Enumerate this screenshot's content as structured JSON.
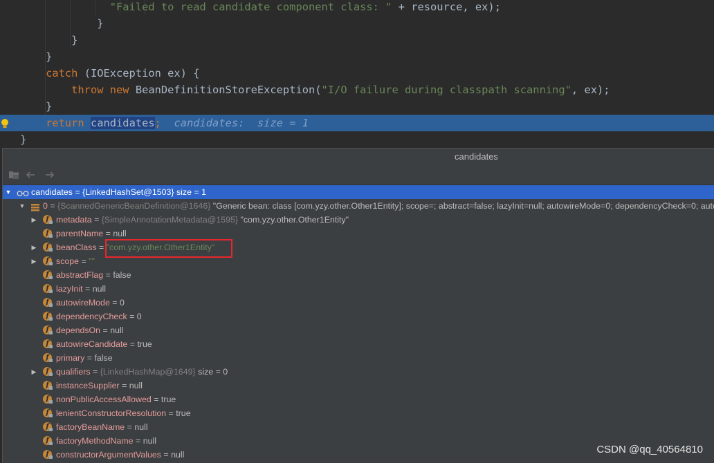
{
  "editor": {
    "lines": [
      {
        "indent": "              ",
        "parts": [
          {
            "t": "\"Failed to read candidate component class: \"",
            "c": "str"
          },
          {
            "t": " + resource, ex);",
            "c": ""
          }
        ]
      },
      {
        "indent": "            ",
        "parts": [
          {
            "t": "}",
            "c": ""
          }
        ]
      },
      {
        "indent": "        ",
        "parts": [
          {
            "t": "}",
            "c": ""
          }
        ]
      },
      {
        "indent": "    ",
        "parts": [
          {
            "t": "}",
            "c": ""
          }
        ]
      },
      {
        "indent": "    ",
        "parts": [
          {
            "t": "catch",
            "c": "kw"
          },
          {
            "t": " (IOException ex) {",
            "c": ""
          }
        ]
      },
      {
        "indent": "        ",
        "parts": [
          {
            "t": "throw new",
            "c": "kw"
          },
          {
            "t": " BeanDefinitionStoreException(",
            "c": ""
          },
          {
            "t": "\"I/O failure during classpath scanning\"",
            "c": "str"
          },
          {
            "t": ", ex);",
            "c": ""
          }
        ]
      },
      {
        "indent": "    ",
        "parts": [
          {
            "t": "}",
            "c": ""
          }
        ]
      },
      {
        "indent": "    ",
        "parts": [
          {
            "t": "return",
            "c": "kw"
          },
          {
            "t": " ",
            "c": ""
          },
          {
            "t": "candidates",
            "c": "sel"
          },
          {
            "t": ";",
            "c": "kw"
          },
          {
            "t": "  candidates:  size = 1",
            "c": "hint"
          }
        ]
      },
      {
        "indent": "",
        "parts": [
          {
            "t": "}",
            "c": ""
          }
        ]
      }
    ]
  },
  "popup": {
    "title": "candidates",
    "toolbar": {
      "icons": [
        "folder-icon",
        "back-arrow-icon",
        "forward-arrow-icon"
      ]
    },
    "root": {
      "name": "candidates",
      "value": " = ",
      "ref": "{LinkedHashSet@1503}",
      "extra": "  size = 1"
    },
    "element": {
      "name": "0",
      "value": " = ",
      "ref": "{ScannedGenericBeanDefinition@1646}",
      "extra": " \"Generic bean: class [com.yzy.other.Other1Entity]; scope=; abstract=false; lazyInit=null; autowireMode=0; dependencyCheck=0; autowireCandidate=true; primary=false\""
    },
    "fields": [
      {
        "name": "metadata",
        "expandable": true,
        "ref": "{SimpleAnnotationMetadata@1595}",
        "value": " \"com.yzy.other.Other1Entity\"",
        "kind": "plainstr"
      },
      {
        "name": "parentName",
        "expandable": false,
        "value": "null",
        "kind": "plain"
      },
      {
        "name": "beanClass",
        "expandable": true,
        "value": "\"com.yzy.other.Other1Entity\"",
        "kind": "str"
      },
      {
        "name": "scope",
        "expandable": true,
        "value": "\"\"",
        "kind": "str"
      },
      {
        "name": "abstractFlag",
        "expandable": false,
        "value": "false",
        "kind": "plain"
      },
      {
        "name": "lazyInit",
        "expandable": false,
        "value": "null",
        "kind": "plain"
      },
      {
        "name": "autowireMode",
        "expandable": false,
        "value": "0",
        "kind": "plain"
      },
      {
        "name": "dependencyCheck",
        "expandable": false,
        "value": "0",
        "kind": "plain"
      },
      {
        "name": "dependsOn",
        "expandable": false,
        "value": "null",
        "kind": "plain"
      },
      {
        "name": "autowireCandidate",
        "expandable": false,
        "value": "true",
        "kind": "plain"
      },
      {
        "name": "primary",
        "expandable": false,
        "value": "false",
        "kind": "plain"
      },
      {
        "name": "qualifiers",
        "expandable": true,
        "ref": "{LinkedHashMap@1649}",
        "value": "  size = 0",
        "kind": "ref"
      },
      {
        "name": "instanceSupplier",
        "expandable": false,
        "value": "null",
        "kind": "plain"
      },
      {
        "name": "nonPublicAccessAllowed",
        "expandable": false,
        "value": "true",
        "kind": "plain"
      },
      {
        "name": "lenientConstructorResolution",
        "expandable": false,
        "value": "true",
        "kind": "plain"
      },
      {
        "name": "factoryBeanName",
        "expandable": false,
        "value": "null",
        "kind": "plain"
      },
      {
        "name": "factoryMethodName",
        "expandable": false,
        "value": "null",
        "kind": "plain"
      },
      {
        "name": "constructorArgumentValues",
        "expandable": false,
        "value": "null",
        "kind": "plain"
      }
    ]
  },
  "watermark": "CSDN @qq_40564810",
  "colors": {
    "editor_bg": "#2b2b2b",
    "current_line": "#2d5f99",
    "popup_bg": "#3c3f41",
    "selected_row": "#2f65ca",
    "highlight_box": "#e8272c"
  }
}
